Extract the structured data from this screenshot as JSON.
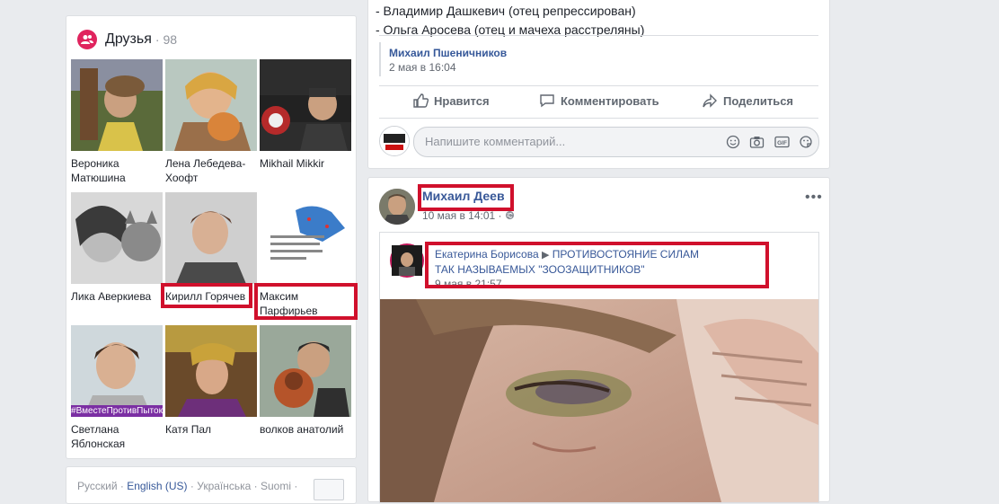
{
  "friends": {
    "title": "Друзья",
    "count": "· 98",
    "items": [
      {
        "name": "Вероника Матюшина"
      },
      {
        "name": "Лена Лебедева-Хоофт"
      },
      {
        "name": "Mikhail Mikkir"
      },
      {
        "name": "Лика Аверкиева"
      },
      {
        "name": "Кирилл Горячев"
      },
      {
        "name": "Максим Парфирьев"
      },
      {
        "name": "Светлана Яблонская",
        "photo_caption": "#ВместеПротивПыток"
      },
      {
        "name": "Катя Пал"
      },
      {
        "name": "волков анатолий"
      }
    ]
  },
  "footer": {
    "languages": [
      "Русский",
      "English (US)",
      "Українська",
      "Suomi"
    ]
  },
  "post1": {
    "lines": [
      "- Владимир Дашкевич (отец репрессирован)",
      "- Ольга Аросева (отец и мачеха расстреляны)"
    ],
    "shared_author": "Михаил Пшеничников",
    "shared_time": "2 мая в 16:04",
    "actions": {
      "like": "Нравится",
      "comment": "Комментировать",
      "share": "Поделиться"
    },
    "comment_placeholder": "Напишите комментарий..."
  },
  "post2": {
    "author": "Михаил Деев",
    "time": "10 мая в 14:01 ·",
    "shared": {
      "author": "Екатерина Борисова",
      "title": "ПРОТИВОСТОЯНИЕ СИЛАМ ТАК НАЗЫВАЕМЫХ \"ЗООЗАЩИТНИКОВ\"",
      "time": "9 мая в 21:57"
    }
  },
  "colors": {
    "highlight": "#d0102c",
    "link": "#365899",
    "friends_icon": "#e0245e"
  }
}
